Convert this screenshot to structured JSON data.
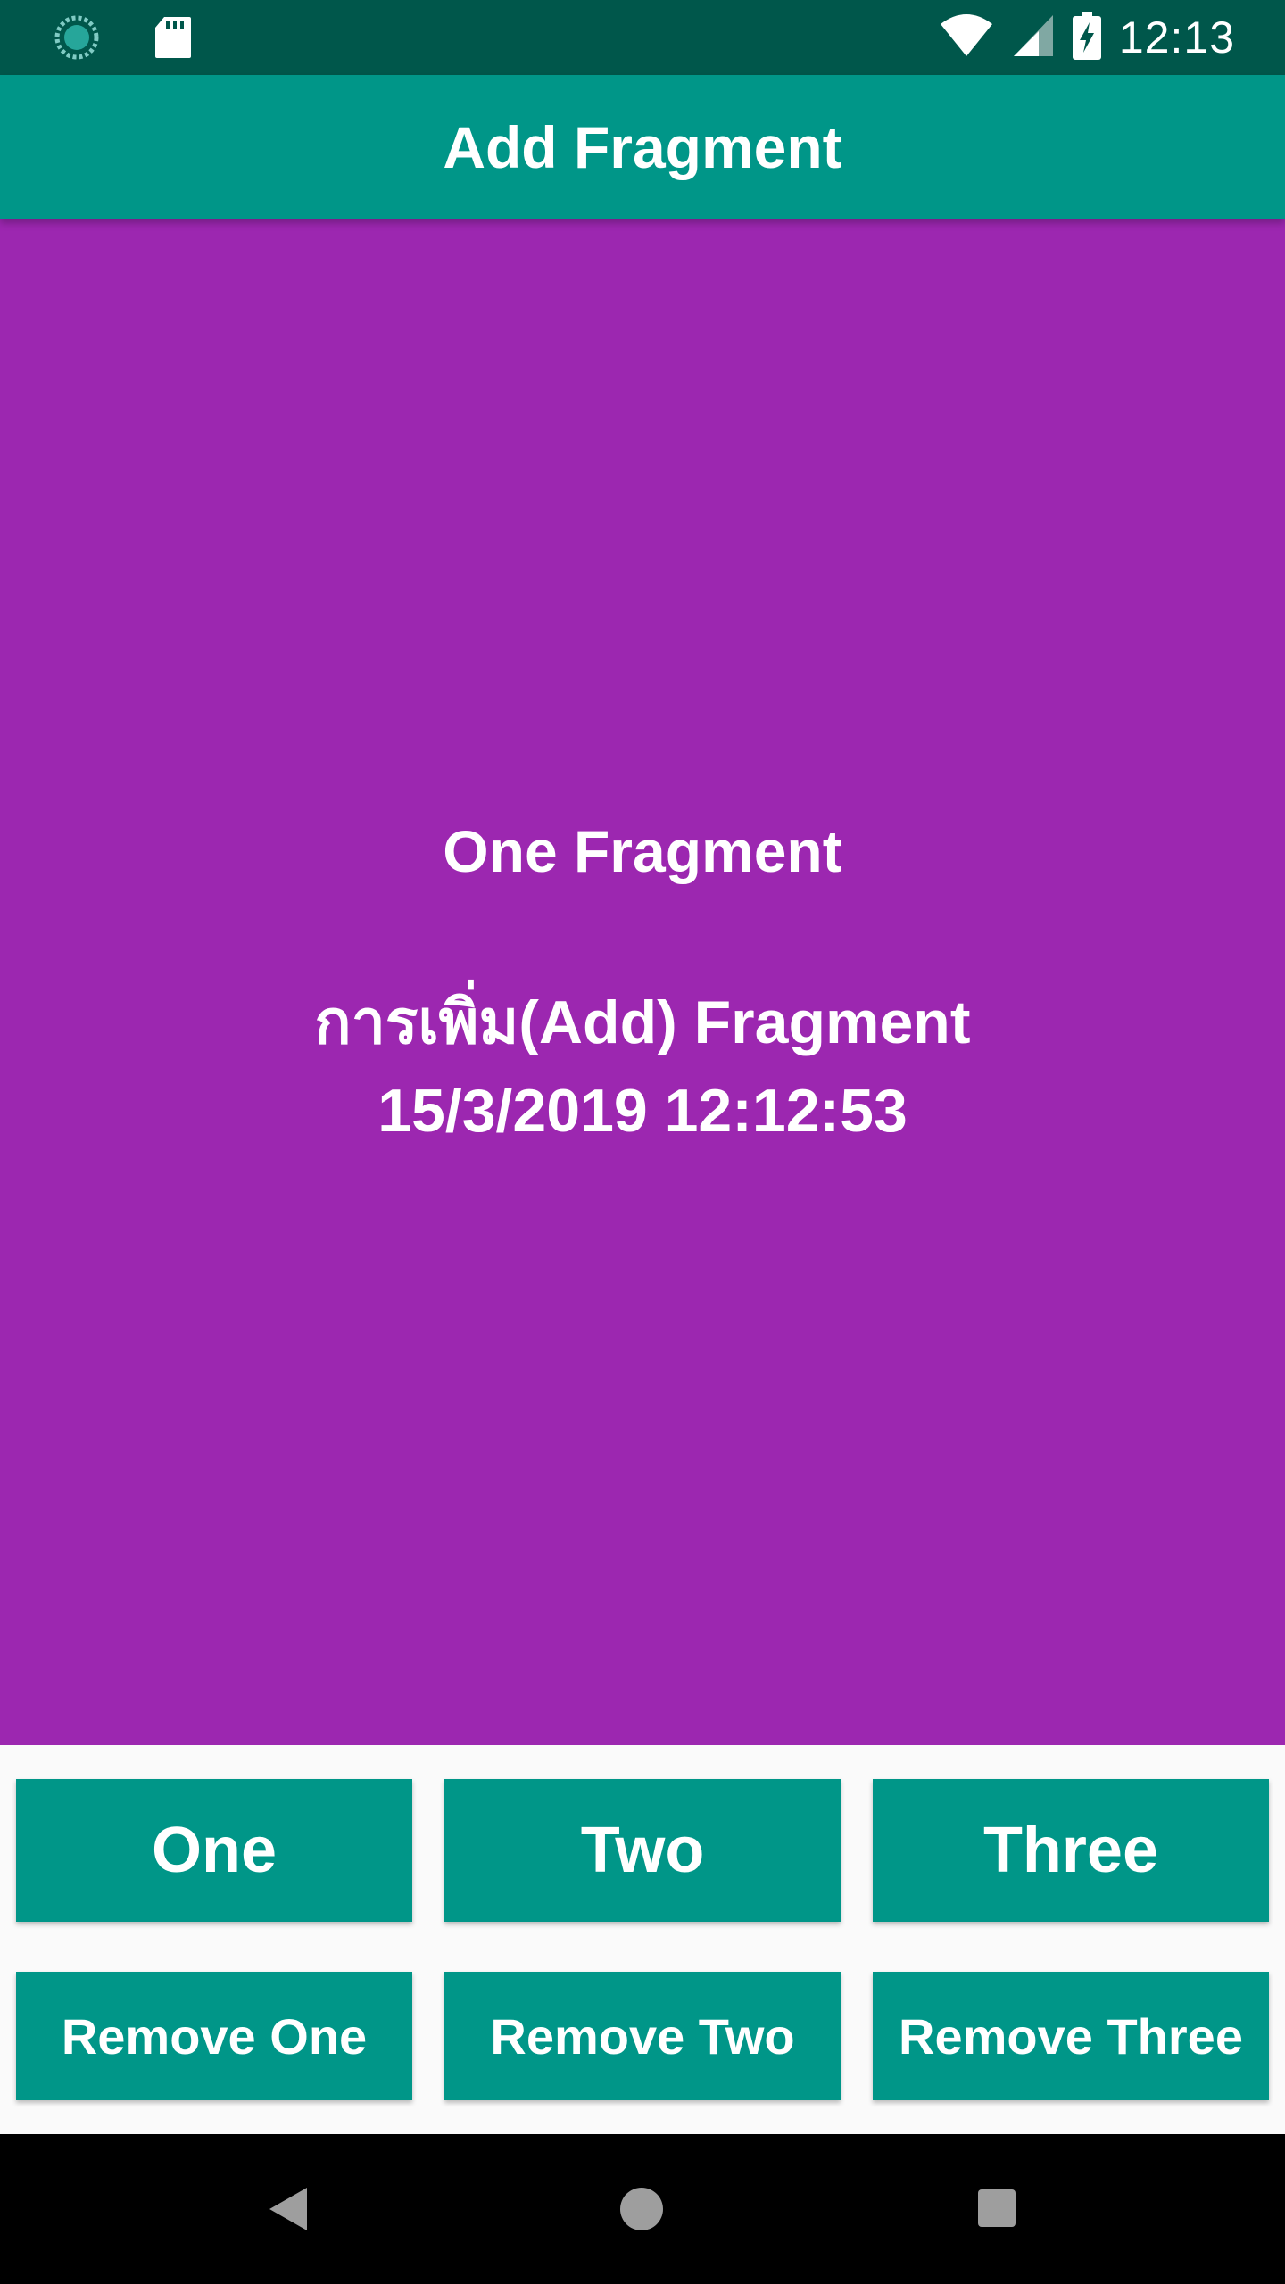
{
  "status_bar": {
    "time": "12:13",
    "icons": [
      "sync-icon",
      "sd-card-icon",
      "wifi-icon",
      "cell-signal-icon",
      "battery-charging-icon"
    ]
  },
  "app_bar": {
    "title": "Add Fragment"
  },
  "fragment": {
    "title": "One Fragment",
    "action": "การเพิ่ม(Add) Fragment",
    "timestamp": "15/3/2019 12:12:53",
    "background": "#9c27b0"
  },
  "buttons": {
    "one": "One",
    "two": "Two",
    "three": "Three",
    "remove_one": "Remove One",
    "remove_two": "Remove Two",
    "remove_three": "Remove Three"
  },
  "colors": {
    "status_bar": "#00574b",
    "primary": "#009688",
    "nav_bar": "#000000"
  },
  "nav_bar": {
    "icons": [
      "back-icon",
      "home-icon",
      "recents-icon"
    ]
  }
}
